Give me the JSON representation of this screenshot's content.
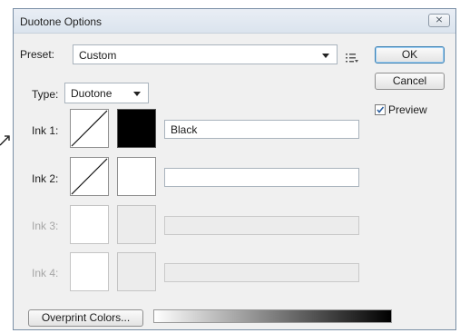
{
  "window": {
    "title": "Duotone Options",
    "close_glyph": "⨯"
  },
  "preset": {
    "label": "Preset:",
    "value": "Custom"
  },
  "buttons": {
    "ok": "OK",
    "cancel": "Cancel",
    "overprint": "Overprint Colors..."
  },
  "preview": {
    "label": "Preview",
    "checked": true
  },
  "type": {
    "label": "Type:",
    "value": "Duotone"
  },
  "inks": [
    {
      "label": "Ink 1:",
      "name": "Black",
      "enabled": true,
      "color": "#000000"
    },
    {
      "label": "Ink 2:",
      "name": "",
      "enabled": true,
      "color": "#ffffff"
    },
    {
      "label": "Ink 3:",
      "name": "",
      "enabled": false
    },
    {
      "label": "Ink 4:",
      "name": "",
      "enabled": false
    }
  ],
  "colors": {
    "accent": "#3c7fb1",
    "disabled_text": "#a6a6a6"
  }
}
